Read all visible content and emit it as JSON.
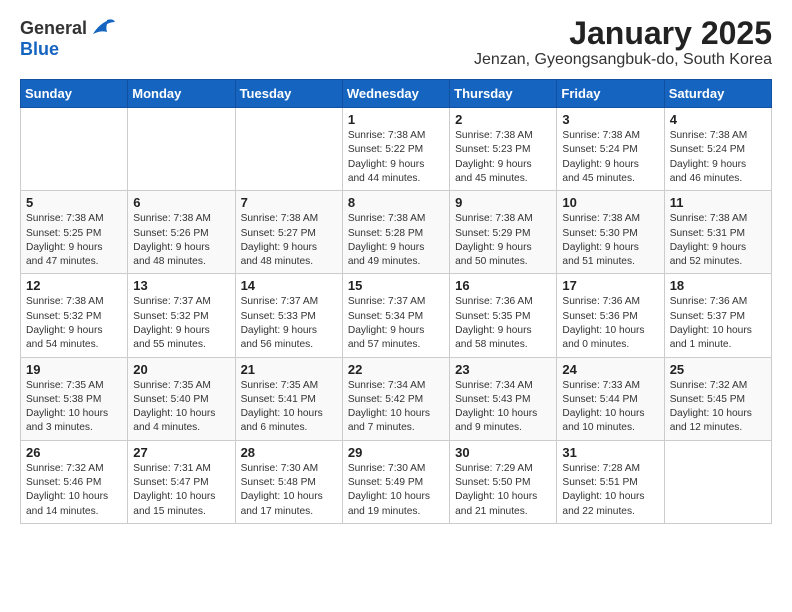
{
  "header": {
    "logo_general": "General",
    "logo_blue": "Blue",
    "title": "January 2025",
    "subtitle": "Jenzan, Gyeongsangbuk-do, South Korea"
  },
  "calendar": {
    "weekdays": [
      "Sunday",
      "Monday",
      "Tuesday",
      "Wednesday",
      "Thursday",
      "Friday",
      "Saturday"
    ],
    "weeks": [
      [
        {
          "day": "",
          "info": ""
        },
        {
          "day": "",
          "info": ""
        },
        {
          "day": "",
          "info": ""
        },
        {
          "day": "1",
          "info": "Sunrise: 7:38 AM\nSunset: 5:22 PM\nDaylight: 9 hours\nand 44 minutes."
        },
        {
          "day": "2",
          "info": "Sunrise: 7:38 AM\nSunset: 5:23 PM\nDaylight: 9 hours\nand 45 minutes."
        },
        {
          "day": "3",
          "info": "Sunrise: 7:38 AM\nSunset: 5:24 PM\nDaylight: 9 hours\nand 45 minutes."
        },
        {
          "day": "4",
          "info": "Sunrise: 7:38 AM\nSunset: 5:24 PM\nDaylight: 9 hours\nand 46 minutes."
        }
      ],
      [
        {
          "day": "5",
          "info": "Sunrise: 7:38 AM\nSunset: 5:25 PM\nDaylight: 9 hours\nand 47 minutes."
        },
        {
          "day": "6",
          "info": "Sunrise: 7:38 AM\nSunset: 5:26 PM\nDaylight: 9 hours\nand 48 minutes."
        },
        {
          "day": "7",
          "info": "Sunrise: 7:38 AM\nSunset: 5:27 PM\nDaylight: 9 hours\nand 48 minutes."
        },
        {
          "day": "8",
          "info": "Sunrise: 7:38 AM\nSunset: 5:28 PM\nDaylight: 9 hours\nand 49 minutes."
        },
        {
          "day": "9",
          "info": "Sunrise: 7:38 AM\nSunset: 5:29 PM\nDaylight: 9 hours\nand 50 minutes."
        },
        {
          "day": "10",
          "info": "Sunrise: 7:38 AM\nSunset: 5:30 PM\nDaylight: 9 hours\nand 51 minutes."
        },
        {
          "day": "11",
          "info": "Sunrise: 7:38 AM\nSunset: 5:31 PM\nDaylight: 9 hours\nand 52 minutes."
        }
      ],
      [
        {
          "day": "12",
          "info": "Sunrise: 7:38 AM\nSunset: 5:32 PM\nDaylight: 9 hours\nand 54 minutes."
        },
        {
          "day": "13",
          "info": "Sunrise: 7:37 AM\nSunset: 5:32 PM\nDaylight: 9 hours\nand 55 minutes."
        },
        {
          "day": "14",
          "info": "Sunrise: 7:37 AM\nSunset: 5:33 PM\nDaylight: 9 hours\nand 56 minutes."
        },
        {
          "day": "15",
          "info": "Sunrise: 7:37 AM\nSunset: 5:34 PM\nDaylight: 9 hours\nand 57 minutes."
        },
        {
          "day": "16",
          "info": "Sunrise: 7:36 AM\nSunset: 5:35 PM\nDaylight: 9 hours\nand 58 minutes."
        },
        {
          "day": "17",
          "info": "Sunrise: 7:36 AM\nSunset: 5:36 PM\nDaylight: 10 hours\nand 0 minutes."
        },
        {
          "day": "18",
          "info": "Sunrise: 7:36 AM\nSunset: 5:37 PM\nDaylight: 10 hours\nand 1 minute."
        }
      ],
      [
        {
          "day": "19",
          "info": "Sunrise: 7:35 AM\nSunset: 5:38 PM\nDaylight: 10 hours\nand 3 minutes."
        },
        {
          "day": "20",
          "info": "Sunrise: 7:35 AM\nSunset: 5:40 PM\nDaylight: 10 hours\nand 4 minutes."
        },
        {
          "day": "21",
          "info": "Sunrise: 7:35 AM\nSunset: 5:41 PM\nDaylight: 10 hours\nand 6 minutes."
        },
        {
          "day": "22",
          "info": "Sunrise: 7:34 AM\nSunset: 5:42 PM\nDaylight: 10 hours\nand 7 minutes."
        },
        {
          "day": "23",
          "info": "Sunrise: 7:34 AM\nSunset: 5:43 PM\nDaylight: 10 hours\nand 9 minutes."
        },
        {
          "day": "24",
          "info": "Sunrise: 7:33 AM\nSunset: 5:44 PM\nDaylight: 10 hours\nand 10 minutes."
        },
        {
          "day": "25",
          "info": "Sunrise: 7:32 AM\nSunset: 5:45 PM\nDaylight: 10 hours\nand 12 minutes."
        }
      ],
      [
        {
          "day": "26",
          "info": "Sunrise: 7:32 AM\nSunset: 5:46 PM\nDaylight: 10 hours\nand 14 minutes."
        },
        {
          "day": "27",
          "info": "Sunrise: 7:31 AM\nSunset: 5:47 PM\nDaylight: 10 hours\nand 15 minutes."
        },
        {
          "day": "28",
          "info": "Sunrise: 7:30 AM\nSunset: 5:48 PM\nDaylight: 10 hours\nand 17 minutes."
        },
        {
          "day": "29",
          "info": "Sunrise: 7:30 AM\nSunset: 5:49 PM\nDaylight: 10 hours\nand 19 minutes."
        },
        {
          "day": "30",
          "info": "Sunrise: 7:29 AM\nSunset: 5:50 PM\nDaylight: 10 hours\nand 21 minutes."
        },
        {
          "day": "31",
          "info": "Sunrise: 7:28 AM\nSunset: 5:51 PM\nDaylight: 10 hours\nand 22 minutes."
        },
        {
          "day": "",
          "info": ""
        }
      ]
    ]
  }
}
